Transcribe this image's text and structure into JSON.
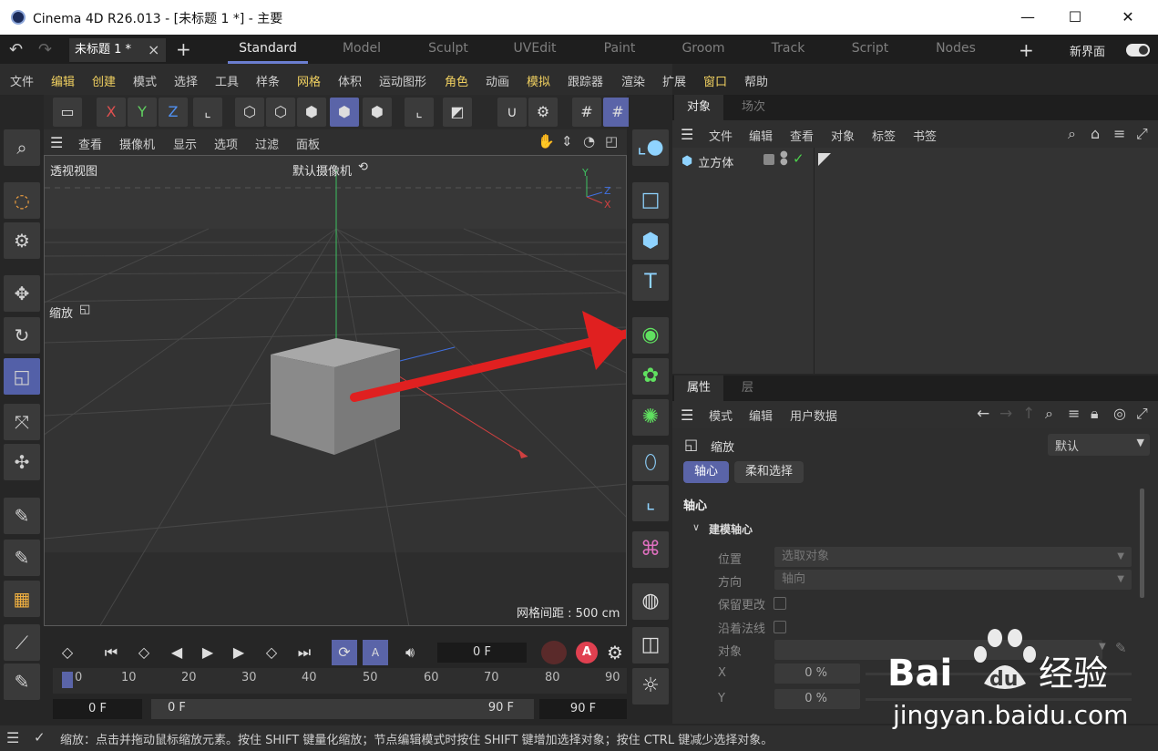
{
  "window": {
    "title": "Cinema 4D R26.013 - [未标题 1 *] - 主要",
    "minimize": "—",
    "maximize": "☐",
    "close": "✕"
  },
  "tabs": {
    "document": "未标题 1 *",
    "close_doc": "×",
    "add_doc": "+",
    "layouts": [
      "Standard",
      "Model",
      "Sculpt",
      "UVEdit",
      "Paint",
      "Groom",
      "Track",
      "Script",
      "Nodes"
    ],
    "add_layout": "+",
    "new_ui": "新界面"
  },
  "menubar": [
    "文件",
    "编辑",
    "创建",
    "模式",
    "选择",
    "工具",
    "样条",
    "网格",
    "体积",
    "运动图形",
    "角色",
    "动画",
    "模拟",
    "跟踪器",
    "渲染",
    "扩展",
    "窗口",
    "帮助"
  ],
  "toolbar": {
    "x": "X",
    "y": "Y",
    "z": "Z"
  },
  "viewport": {
    "menu": [
      "查看",
      "摄像机",
      "显示",
      "选项",
      "过滤",
      "面板"
    ],
    "view_name": "透视视图",
    "camera": "默认摄像机",
    "tool_label": "缩放",
    "grid_spacing": "网格间距 : 500 cm",
    "axis_y": "Y",
    "axis_z": "Z",
    "axis_x": "X"
  },
  "object_manager": {
    "tabs": [
      "对象",
      "场次"
    ],
    "menu": [
      "文件",
      "编辑",
      "查看",
      "对象",
      "标签",
      "书签"
    ],
    "objects": [
      {
        "name": "立方体"
      }
    ]
  },
  "attributes": {
    "tabs": [
      "属性",
      "层"
    ],
    "menu": [
      "模式",
      "编辑",
      "用户数据"
    ],
    "tool_name": "缩放",
    "preset": "默认",
    "subtabs": [
      "轴心",
      "柔和选择"
    ],
    "section": "轴心",
    "group": "建模轴心",
    "fields": {
      "position_label": "位置",
      "position_value": "选取对象",
      "direction_label": "方向",
      "direction_value": "轴向",
      "keep_label": "保留更改",
      "normal_label": "沿着法线",
      "object_label": "对象",
      "x_label": "X",
      "x_value": "0 %",
      "y_label": "Y",
      "y_value": "0 %"
    }
  },
  "timeline": {
    "current_frame": "0 F",
    "ruler": [
      "0",
      "10",
      "20",
      "30",
      "40",
      "50",
      "60",
      "70",
      "80",
      "90"
    ],
    "start": "0 F",
    "range_start": "0 F",
    "range_end": "90 F",
    "end": "90 F"
  },
  "status": {
    "text": "缩放：点击并拖动鼠标缩放元素。按住 SHIFT 键量化缩放；节点编辑模式时按住 SHIFT 键增加选择对象；按住 CTRL 键减少选择对象。"
  },
  "watermark": {
    "brand": "Bai",
    "brand2": "du",
    "cn": "经验",
    "url": "jingyan.baidu.com"
  },
  "colors": {
    "accent": "#5a64a8",
    "arrow": "#e02020",
    "check": "#4cd04c"
  }
}
